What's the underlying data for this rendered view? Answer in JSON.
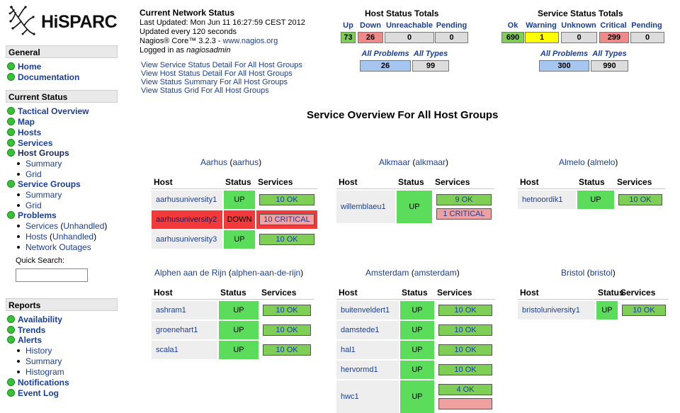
{
  "brand": "HiSPARC",
  "sidebar": {
    "general_header": "General",
    "general_items": [
      "Home",
      "Documentation"
    ],
    "current_header": "Current Status",
    "current_items": {
      "tactical": "Tactical Overview",
      "map": "Map",
      "hosts": "Hosts",
      "services": "Services",
      "host_groups": "Host Groups",
      "hg_summary": "Summary",
      "hg_grid": "Grid",
      "service_groups": "Service Groups",
      "sg_summary": "Summary",
      "sg_grid": "Grid",
      "problems": "Problems",
      "pr_services": "Services",
      "pr_services_unh": "Unhandled",
      "pr_hosts": "Hosts",
      "pr_hosts_unh": "Unhandled",
      "pr_outages": "Network Outages"
    },
    "quick_search_label": "Quick Search:",
    "reports_header": "Reports",
    "reports_items": {
      "availability": "Availability",
      "trends": "Trends",
      "alerts": "Alerts",
      "history": "History",
      "summary": "Summary",
      "histogram": "Histogram",
      "notifications": "Notifications",
      "event_log": "Event Log"
    }
  },
  "network_status": {
    "title": "Current Network Status",
    "last_updated": "Last Updated: Mon Jun 11 16:27:59 CEST 2012",
    "interval": "Updated every 120 seconds",
    "core": "Nagios® Core™ 3.2.3 - ",
    "core_link": "www.nagios.org",
    "logged_prefix": "Logged in as ",
    "user": "nagiosadmin"
  },
  "status_links": [
    "View Service Status Detail For All Host Groups",
    "View Host Status Detail For All Host Groups",
    "View Status Summary For All Host Groups",
    "View Status Grid For All Host Groups"
  ],
  "host_totals": {
    "title": "Host Status Totals",
    "labels": [
      "Up",
      "Down",
      "Unreachable",
      "Pending"
    ],
    "values": [
      "73",
      "26",
      "0",
      "0"
    ],
    "colors": [
      "#7fcf56",
      "#f08a8a",
      "#dcdcdc",
      "#dcdcdc"
    ],
    "all_problems_label": "All Problems",
    "all_types_label": "All Types",
    "all_problems": "26",
    "all_types": "99"
  },
  "service_totals": {
    "title": "Service Status Totals",
    "labels": [
      "Ok",
      "Warning",
      "Unknown",
      "Critical",
      "Pending"
    ],
    "values": [
      "690",
      "1",
      "0",
      "299",
      "0"
    ],
    "colors": [
      "#7fcf56",
      "#ffff00",
      "#dcdcdc",
      "#f08a8a",
      "#dcdcdc"
    ],
    "all_problems_label": "All Problems",
    "all_types_label": "All Types",
    "all_problems": "300",
    "all_types": "990"
  },
  "overview_title": "Service Overview For All Host Groups",
  "col_headers": {
    "host": "Host",
    "status": "Status",
    "services": "Services"
  },
  "groups": [
    {
      "name": "Aarhus",
      "alias": "aarhus",
      "hosts": [
        {
          "host": "aarhusuniversity1",
          "status": "UP",
          "services": [
            "10 OK"
          ]
        },
        {
          "host": "aarhusuniversity2",
          "status": "DOWN",
          "services": [
            "10 CRITICAL"
          ]
        },
        {
          "host": "aarhusuniversity3",
          "status": "UP",
          "services": [
            "10 OK"
          ]
        }
      ]
    },
    {
      "name": "Alkmaar",
      "alias": "alkmaar",
      "hosts": [
        {
          "host": "willemblaeu1",
          "status": "UP",
          "services": [
            "9 OK",
            "1 CRITICAL"
          ]
        }
      ]
    },
    {
      "name": "Almelo",
      "alias": "almelo",
      "hosts": [
        {
          "host": "hetnoordik1",
          "status": "UP",
          "services": [
            "10 OK"
          ]
        }
      ]
    },
    {
      "name": "Alphen aan de Rijn",
      "alias": "alphen-aan-de-rijn",
      "hosts": [
        {
          "host": "ashram1",
          "status": "UP",
          "services": [
            "10 OK"
          ]
        },
        {
          "host": "groenehart1",
          "status": "UP",
          "services": [
            "10 OK"
          ]
        },
        {
          "host": "scala1",
          "status": "UP",
          "services": [
            "10 OK"
          ]
        }
      ]
    },
    {
      "name": "Amsterdam",
      "alias": "amsterdam",
      "hosts": [
        {
          "host": "buitenveldert1",
          "status": "UP",
          "services": [
            "10 OK"
          ]
        },
        {
          "host": "damstede1",
          "status": "UP",
          "services": [
            "10 OK"
          ]
        },
        {
          "host": "hal1",
          "status": "UP",
          "services": [
            "10 OK"
          ]
        },
        {
          "host": "hervormd1",
          "status": "UP",
          "services": [
            "10 OK"
          ]
        },
        {
          "host": "hwc1",
          "status": "UP",
          "services": [
            "4 OK",
            ""
          ]
        }
      ]
    },
    {
      "name": "Bristol",
      "alias": "bristol",
      "hosts": [
        {
          "host": "bristoluniversity1",
          "status": "UP",
          "services": [
            "10 OK"
          ]
        }
      ]
    }
  ]
}
